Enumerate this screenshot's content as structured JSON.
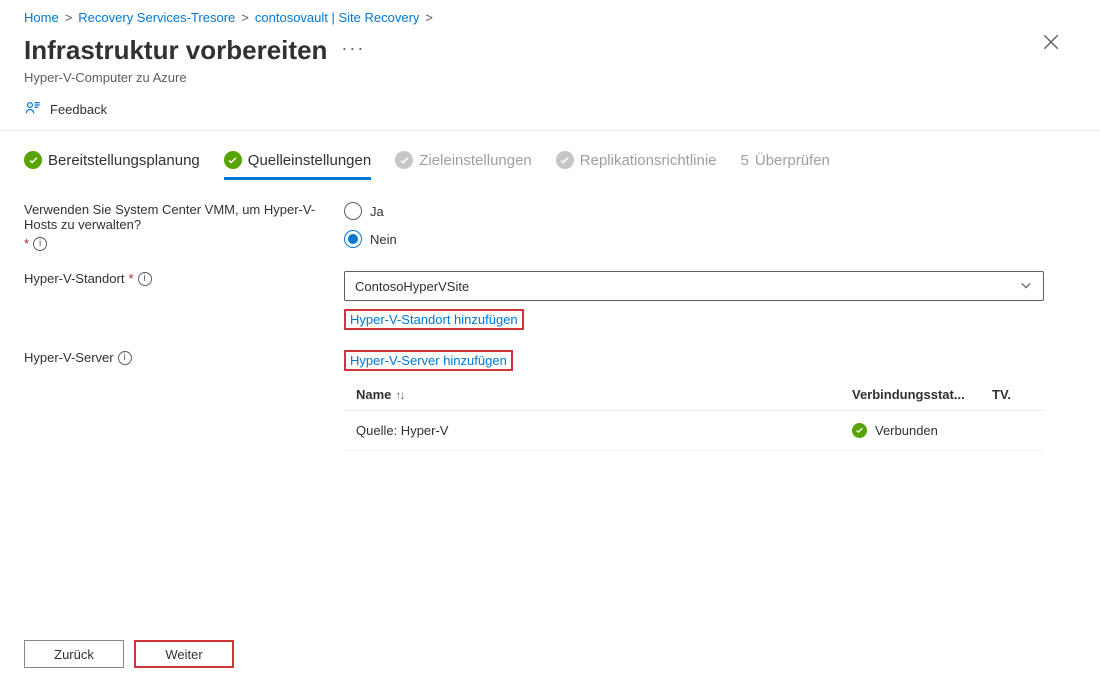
{
  "breadcrumb": {
    "home": "Home",
    "vaults": "Recovery Services-Tresore",
    "current": "contosovault | Site Recovery"
  },
  "header": {
    "title": "Infrastruktur vorbereiten",
    "subtitle": "Hyper-V-Computer zu Azure"
  },
  "feedback": {
    "label": "Feedback"
  },
  "steps": {
    "s1": "Bereitstellungsplanung",
    "s2": "Quelleinstellungen",
    "s3": "Zieleinstellungen",
    "s4": "Replikationsrichtlinie",
    "s5num": "5",
    "s5": "Überprüfen"
  },
  "form": {
    "vmm_label": "Verwenden Sie System Center VMM, um Hyper-V-Hosts zu verwalten?",
    "yes": "Ja",
    "no": "Nein",
    "site_label": "Hyper-V-Standort",
    "site_value": "ContosoHyperVSite",
    "add_site_link": "Hyper-V-Standort hinzufügen",
    "server_label": "Hyper-V-Server",
    "add_server_link": "Hyper-V-Server hinzufügen"
  },
  "table": {
    "col_name": "Name",
    "col_conn": "Verbindungsstat...",
    "col_tv": "TV.",
    "row1_name": "Quelle: Hyper-V",
    "row1_status": "Verbunden"
  },
  "footer": {
    "back": "Zurück",
    "next": "Weiter"
  }
}
